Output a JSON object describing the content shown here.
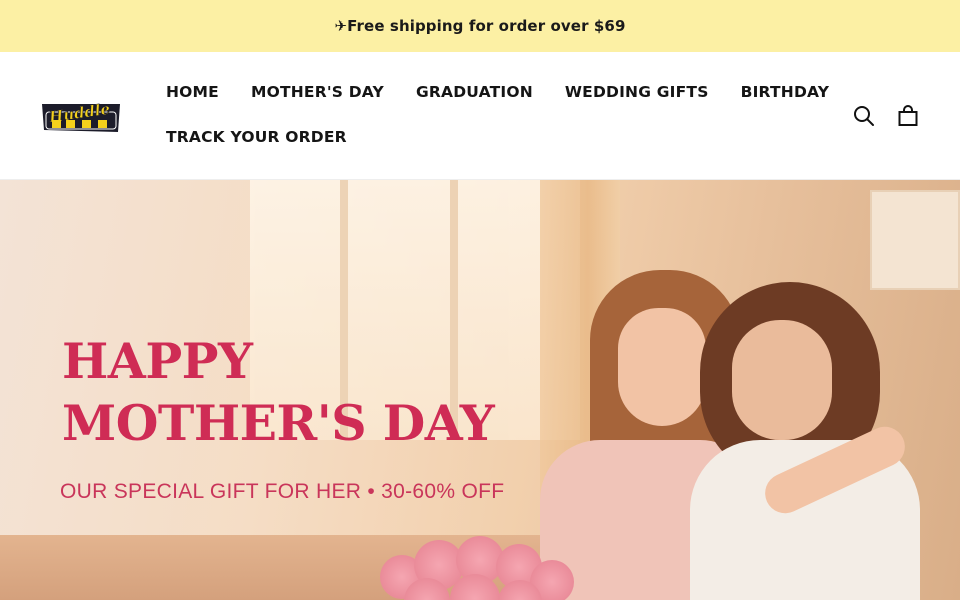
{
  "announcement": {
    "text": "✈Free shipping for order over $69"
  },
  "brand": {
    "logo_text": "Huddle"
  },
  "nav": {
    "items": [
      {
        "label": "HOME"
      },
      {
        "label": "MOTHER'S DAY"
      },
      {
        "label": "GRADUATION"
      },
      {
        "label": "WEDDING GIFTS"
      },
      {
        "label": "BIRTHDAY"
      },
      {
        "label": "TRACK YOUR ORDER"
      }
    ]
  },
  "header_icons": {
    "search": "search-icon",
    "cart": "bag-icon"
  },
  "hero": {
    "headline_line1": "HAPPY",
    "headline_line2": "MOTHER'S DAY",
    "subline": "OUR SPECIAL GIFT FOR HER • 30-60% OFF"
  },
  "colors": {
    "announcement_bg": "#fcf0a4",
    "headline": "#cf2c55",
    "logo_yellow": "#f5d11c"
  }
}
